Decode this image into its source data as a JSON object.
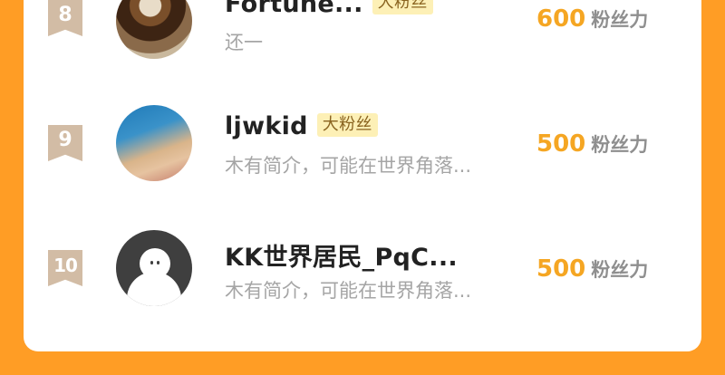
{
  "rows": [
    {
      "rank": "8",
      "name": "Fortune...",
      "badge": "大粉丝",
      "bio": "还一",
      "fans": "600",
      "fans_unit": "粉丝力",
      "avatar_icon": "clock-photo"
    },
    {
      "rank": "9",
      "name": "ljwkid",
      "badge": "大粉丝",
      "bio": "木有简介，可能在世界角落...",
      "fans": "500",
      "fans_unit": "粉丝力",
      "avatar_icon": "child-photo"
    },
    {
      "rank": "10",
      "name": "KK世界居民_PqC...",
      "badge": "",
      "bio": "木有简介，可能在世界角落...",
      "fans": "500",
      "fans_unit": "粉丝力",
      "avatar_icon": "default-avatar-icon"
    }
  ],
  "colors": {
    "background": "#ff9d25",
    "card": "#ffffff",
    "rank_badge": "#d2bca5",
    "fans_number": "#f5a623",
    "fan_badge_bg": "#fdf0b6"
  }
}
